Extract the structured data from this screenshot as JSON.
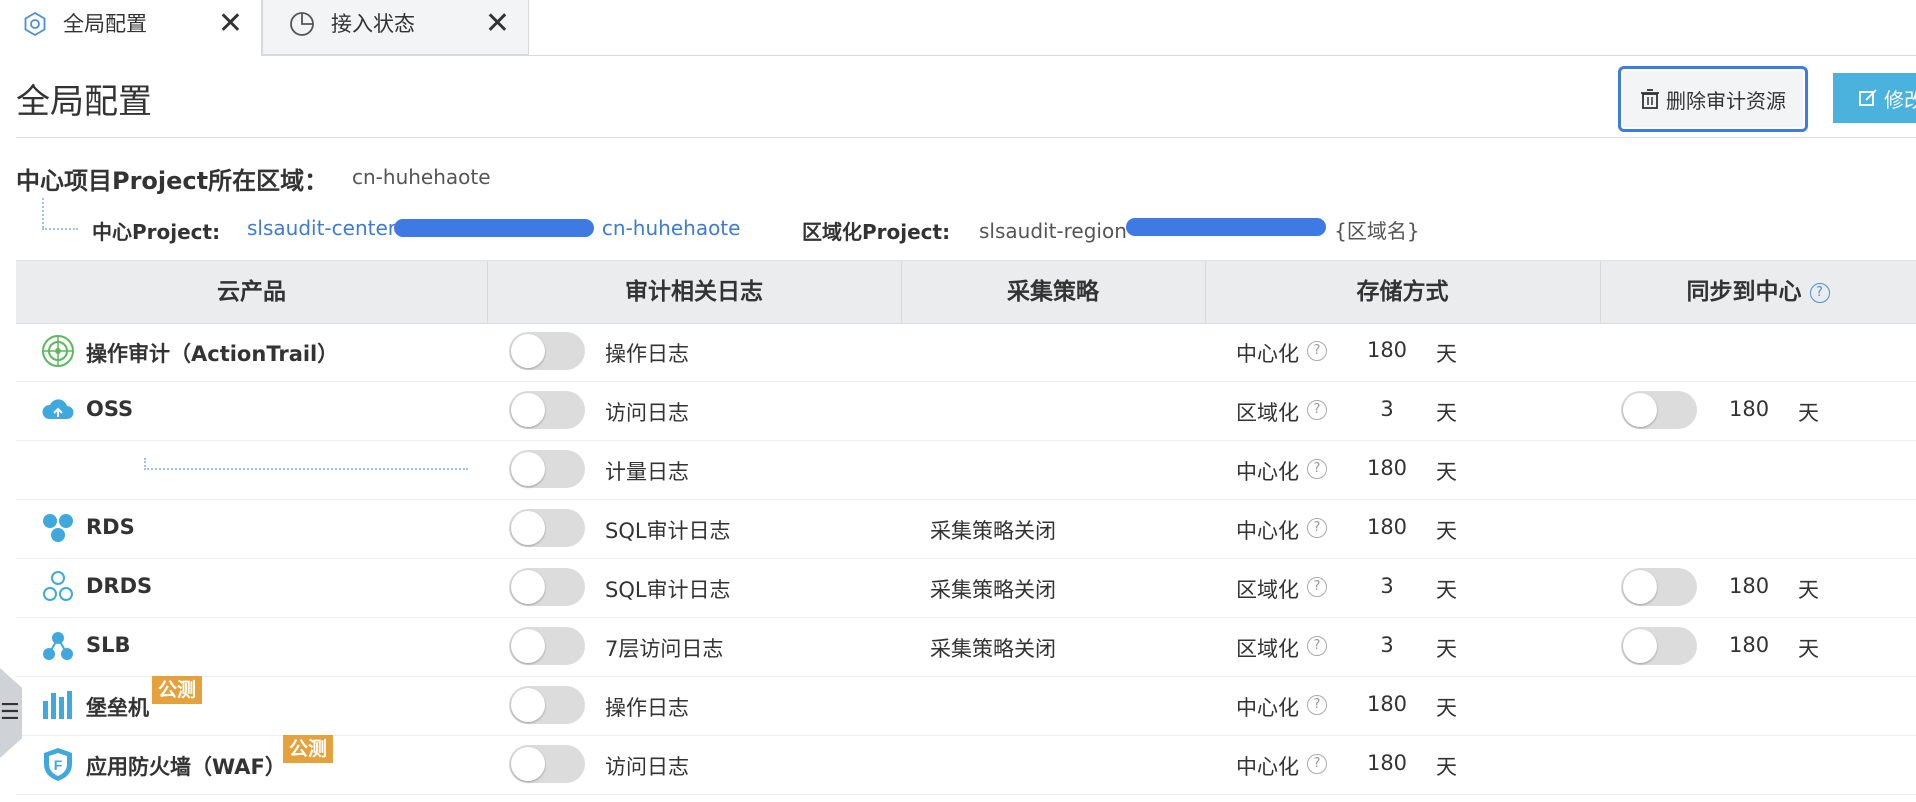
{
  "tabs": [
    {
      "label": "全局配置",
      "icon": "settings-circle-icon",
      "active": true
    },
    {
      "label": "接入状态",
      "icon": "pie-chart-icon",
      "active": false
    }
  ],
  "close_glyph": "✕",
  "header": {
    "title": "全局配置",
    "delete_button": "删除审计资源",
    "modify_button": "修改"
  },
  "info": {
    "center_region_label": "中心项目Project所在区域：",
    "center_region_value": "cn-huhehaote",
    "center_project_label": "中心Project:",
    "center_project_prefix": "slsaudit-center-",
    "center_project_suffix": "cn-huhehaote",
    "region_project_label": "区域化Project:",
    "region_project_prefix": "slsaudit-region-",
    "region_project_suffix": "{区域名}"
  },
  "table": {
    "headers": [
      "云产品",
      "审计相关日志",
      "采集策略",
      "存储方式",
      "同步到中心"
    ],
    "help_glyph": "?",
    "beta_label": "公测",
    "days_unit": "天",
    "rows": [
      {
        "product": "操作审计（ActionTrail）",
        "icon": "actiontrail-icon",
        "log": "操作日志",
        "policy": "",
        "storage": "中心化",
        "days": "180",
        "sync": false,
        "sync_days": ""
      },
      {
        "product": "OSS",
        "icon": "oss-cloud-icon",
        "log": "访问日志",
        "policy": "",
        "storage": "区域化",
        "days": "3",
        "sync": true,
        "sync_days": "180"
      },
      {
        "product": "",
        "icon": "",
        "log": "计量日志",
        "policy": "",
        "storage": "中心化",
        "days": "180",
        "sync": false,
        "sync_days": ""
      },
      {
        "product": "RDS",
        "icon": "rds-icon",
        "log": "SQL审计日志",
        "policy": "采集策略关闭",
        "storage": "中心化",
        "days": "180",
        "sync": false,
        "sync_days": ""
      },
      {
        "product": "DRDS",
        "icon": "drds-icon",
        "log": "SQL审计日志",
        "policy": "采集策略关闭",
        "storage": "区域化",
        "days": "3",
        "sync": true,
        "sync_days": "180"
      },
      {
        "product": "SLB",
        "icon": "slb-icon",
        "log": "7层访问日志",
        "policy": "采集策略关闭",
        "storage": "区域化",
        "days": "3",
        "sync": true,
        "sync_days": "180"
      },
      {
        "product": "堡垒机",
        "icon": "bastion-host-icon",
        "beta": true,
        "log": "操作日志",
        "policy": "",
        "storage": "中心化",
        "days": "180",
        "sync": false,
        "sync_days": ""
      },
      {
        "product": "应用防火墙（WAF）",
        "icon": "waf-shield-icon",
        "beta": true,
        "log": "访问日志",
        "policy": "",
        "storage": "中心化",
        "days": "180",
        "sync": false,
        "sync_days": ""
      }
    ]
  },
  "colors": {
    "accent": "#3e7de0",
    "link": "#3d7bd6",
    "beta": "#e5a23c",
    "modify_button": "#4ab2dc"
  }
}
